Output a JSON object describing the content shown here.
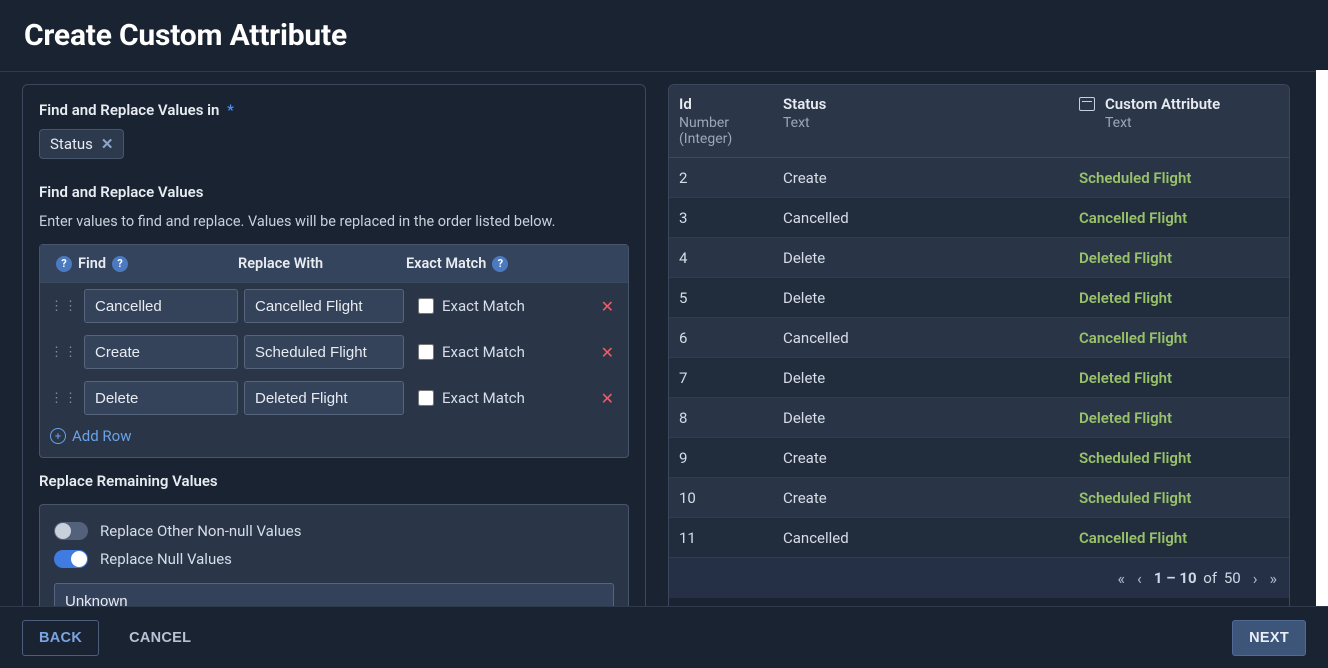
{
  "header": {
    "title": "Create Custom Attribute"
  },
  "find_in": {
    "label": "Find and Replace Values in",
    "chip": "Status"
  },
  "find_values": {
    "label": "Find and Replace Values",
    "hint": "Enter values to find and replace. Values will be replaced in the order listed below.",
    "cols": {
      "find": "Find",
      "replace": "Replace With",
      "exact": "Exact Match"
    },
    "rows": [
      {
        "find": "Cancelled",
        "replace": "Cancelled Flight",
        "exact_label": "Exact Match"
      },
      {
        "find": "Create",
        "replace": "Scheduled Flight",
        "exact_label": "Exact Match"
      },
      {
        "find": "Delete",
        "replace": "Deleted Flight",
        "exact_label": "Exact Match"
      }
    ],
    "add_row": "Add Row"
  },
  "remaining": {
    "label": "Replace Remaining Values",
    "opt_nonnull": "Replace Other Non-null Values",
    "opt_null": "Replace Null Values",
    "value": "Unknown"
  },
  "preview": {
    "cols": {
      "id": {
        "name": "Id",
        "type": "Number (Integer)"
      },
      "status": {
        "name": "Status",
        "type": "Text"
      },
      "custom": {
        "name": "Custom Attribute",
        "type": "Text"
      }
    },
    "rows": [
      {
        "id": "2",
        "status": "Create",
        "custom": "Scheduled Flight"
      },
      {
        "id": "3",
        "status": "Cancelled",
        "custom": "Cancelled Flight"
      },
      {
        "id": "4",
        "status": "Delete",
        "custom": "Deleted Flight"
      },
      {
        "id": "5",
        "status": "Delete",
        "custom": "Deleted Flight"
      },
      {
        "id": "6",
        "status": "Cancelled",
        "custom": "Cancelled Flight"
      },
      {
        "id": "7",
        "status": "Delete",
        "custom": "Deleted Flight"
      },
      {
        "id": "8",
        "status": "Delete",
        "custom": "Deleted Flight"
      },
      {
        "id": "9",
        "status": "Create",
        "custom": "Scheduled Flight"
      },
      {
        "id": "10",
        "status": "Create",
        "custom": "Scheduled Flight"
      },
      {
        "id": "11",
        "status": "Cancelled",
        "custom": "Cancelled Flight"
      }
    ],
    "pagination": {
      "range": "1 – 10",
      "of_label": "of",
      "total": "50"
    }
  },
  "footer": {
    "back": "BACK",
    "cancel": "CANCEL",
    "next": "NEXT"
  }
}
